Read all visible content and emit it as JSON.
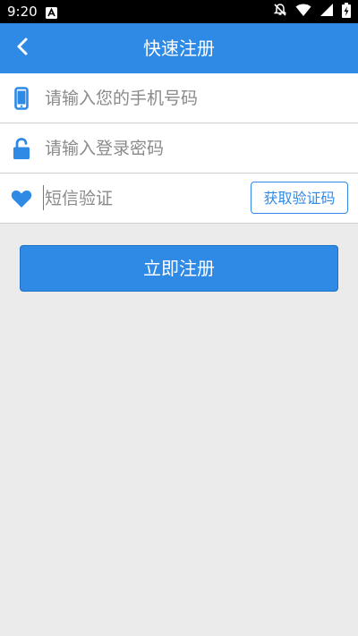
{
  "status_bar": {
    "time": "9:20",
    "notification_icon": "a-letter-icon",
    "right_icons": [
      "notifications-off-icon",
      "wifi-icon",
      "signal-icon",
      "battery-charging-icon"
    ]
  },
  "header": {
    "back_icon": "chevron-left-icon",
    "title": "快速注册"
  },
  "form": {
    "phone": {
      "icon": "phone-icon",
      "placeholder": "请输入您的手机号码",
      "value": ""
    },
    "password": {
      "icon": "unlock-icon",
      "placeholder": "请输入登录密码",
      "value": ""
    },
    "sms": {
      "icon": "heart-icon",
      "placeholder": "短信验证",
      "value": "",
      "get_code_label": "获取验证码"
    }
  },
  "actions": {
    "register_label": "立即注册"
  },
  "colors": {
    "primary": "#2f8ae5",
    "background": "#ebebeb",
    "status_bar": "#000000"
  }
}
